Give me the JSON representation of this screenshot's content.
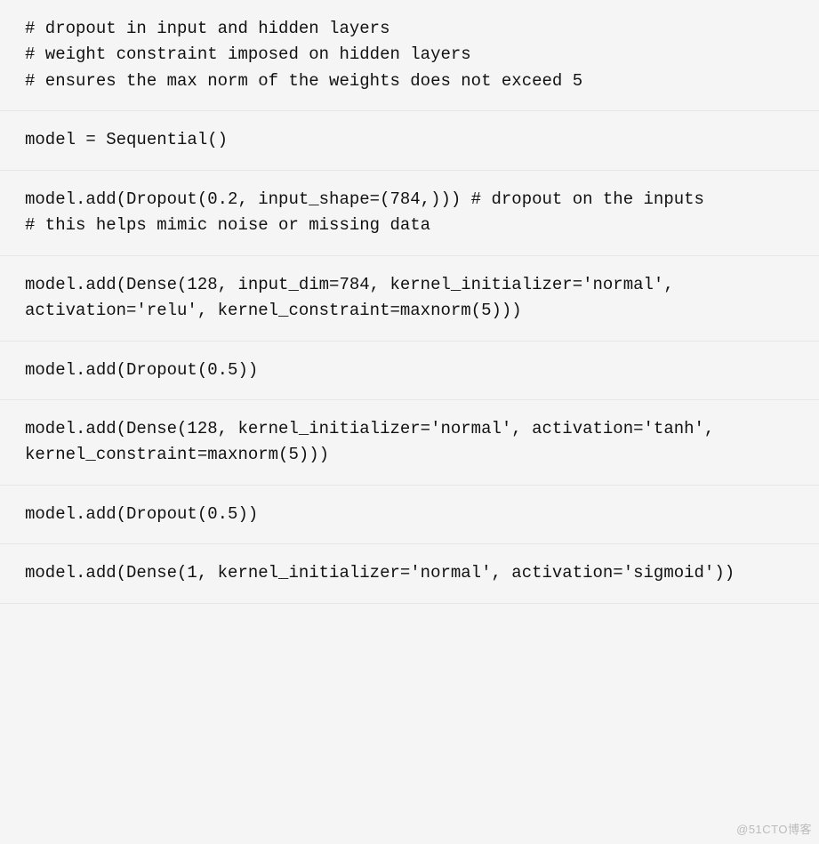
{
  "cells": [
    "# dropout in input and hidden layers\n# weight constraint imposed on hidden layers\n# ensures the max norm of the weights does not exceed 5",
    "model = Sequential()",
    "model.add(Dropout(0.2, input_shape=(784,))) # dropout on the inputs\n# this helps mimic noise or missing data",
    "model.add(Dense(128, input_dim=784, kernel_initializer='normal', activation='relu', kernel_constraint=maxnorm(5)))",
    "model.add(Dropout(0.5))",
    "model.add(Dense(128, kernel_initializer='normal', activation='tanh', kernel_constraint=maxnorm(5)))",
    "model.add(Dropout(0.5))",
    "model.add(Dense(1, kernel_initializer='normal', activation='sigmoid'))"
  ],
  "watermark": "@51CTO博客"
}
